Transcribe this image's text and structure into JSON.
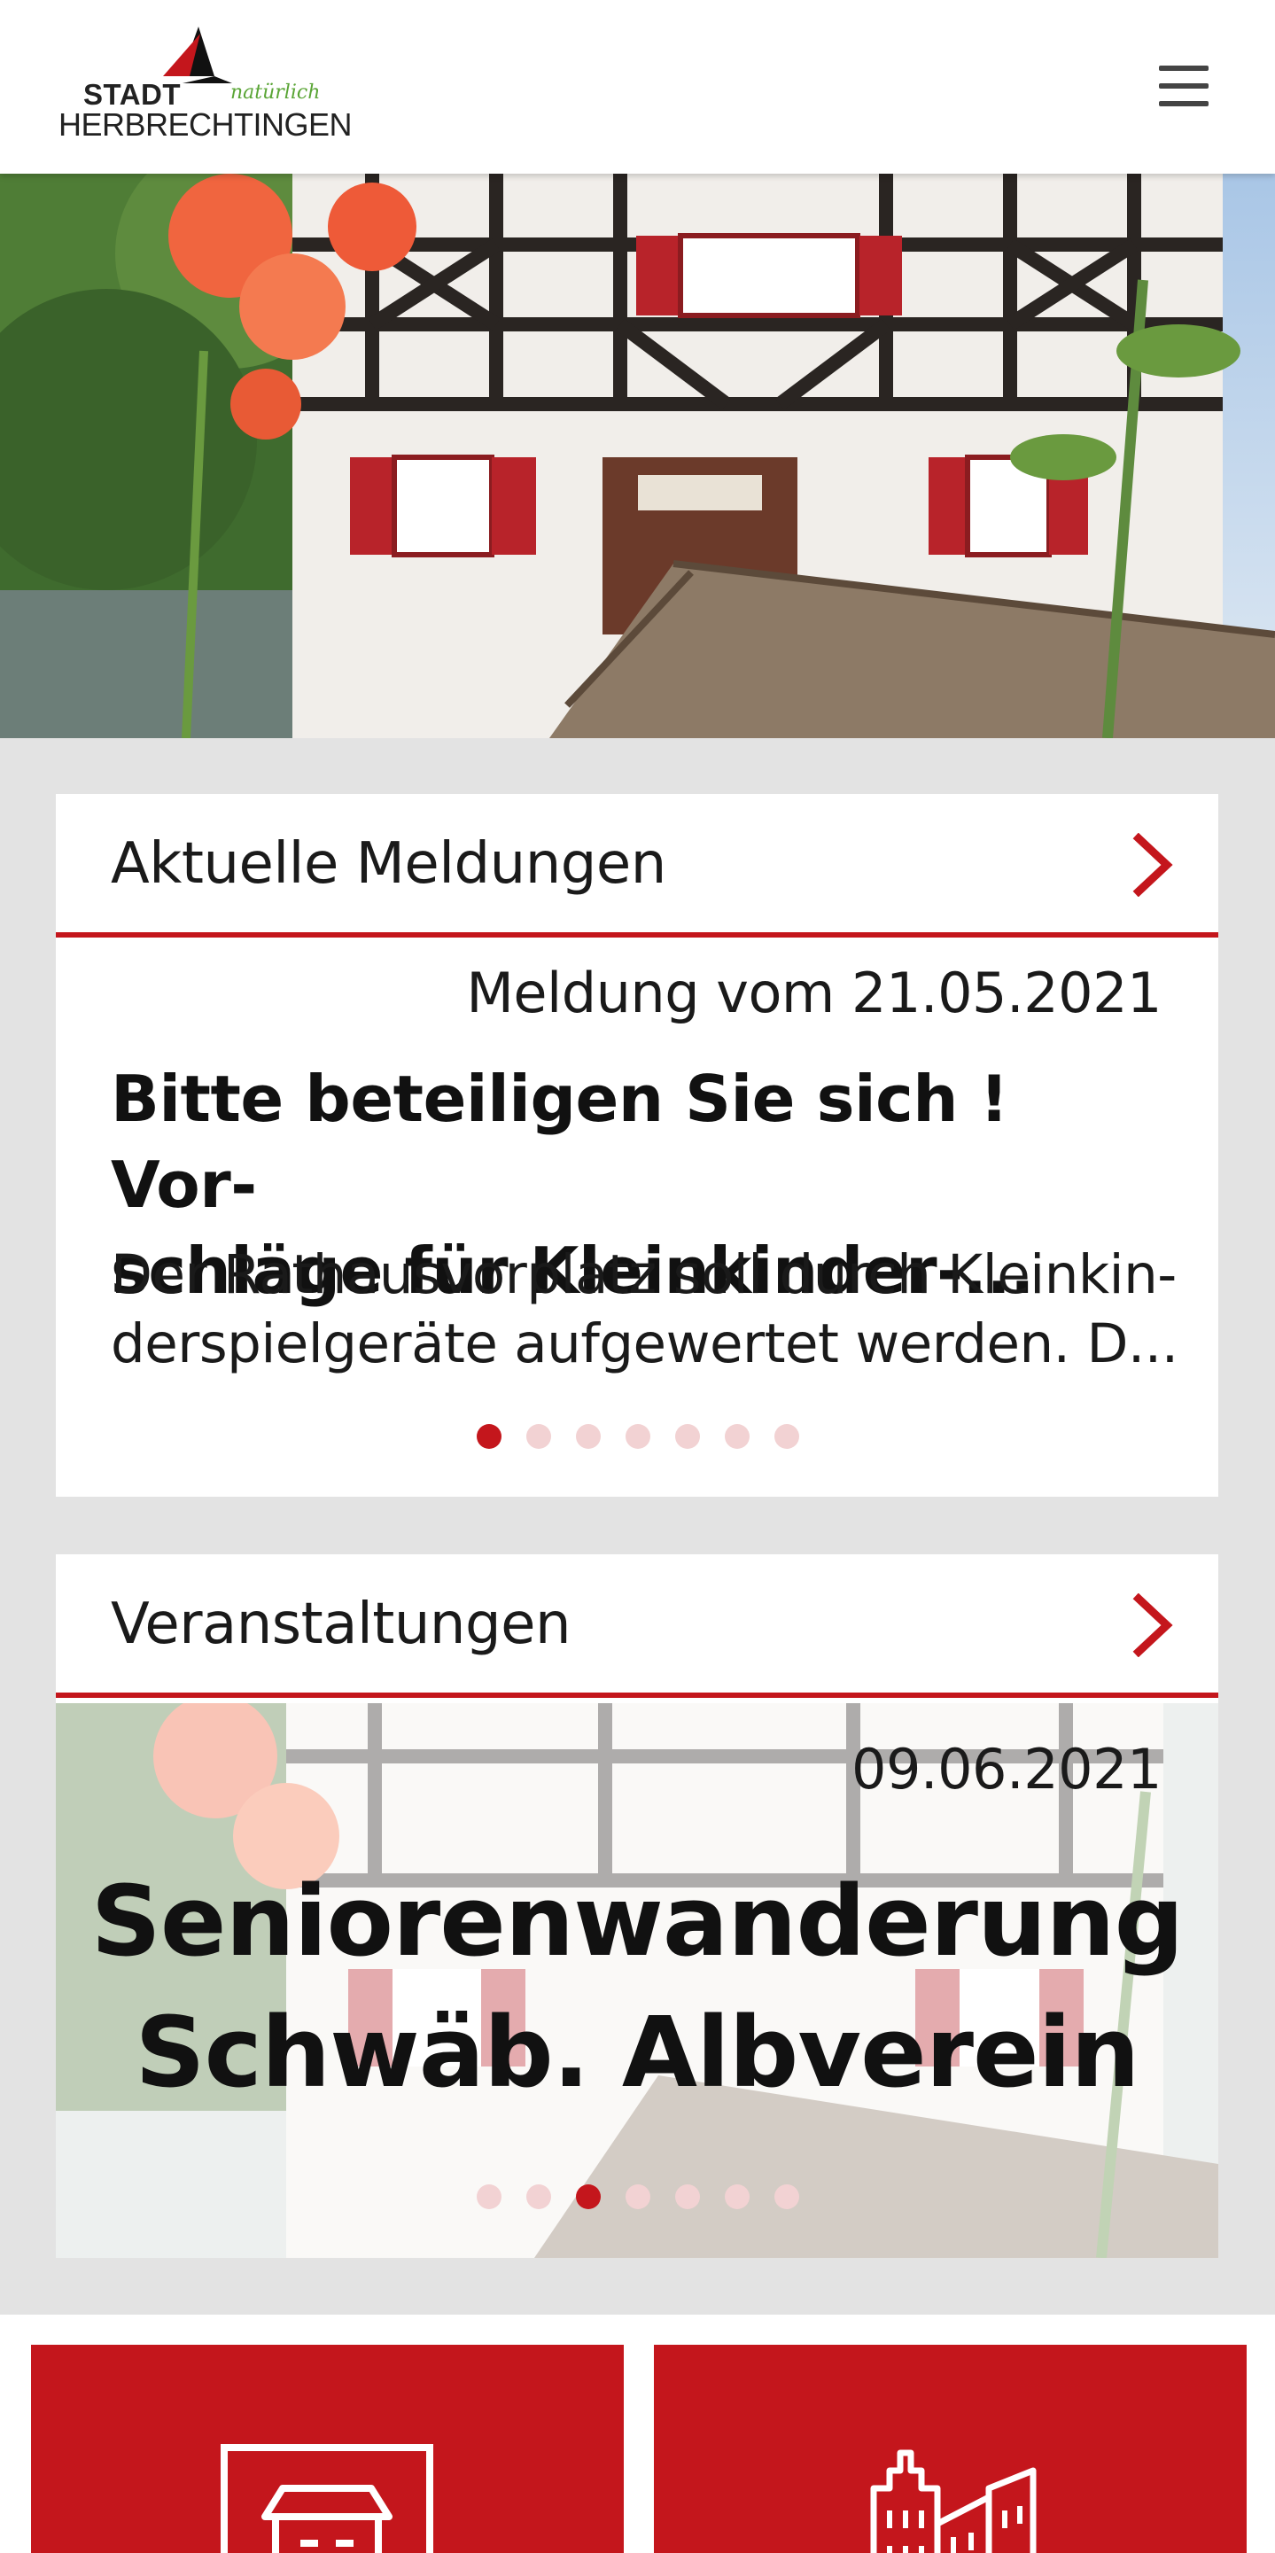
{
  "header": {
    "logo": {
      "word_top": "STADT",
      "tagline": "natürlich",
      "word_bottom": "HERBRECHTINGEN"
    },
    "menu_icon": "hamburger-menu-icon"
  },
  "news": {
    "title": "Aktuelle Meldungen",
    "date": "Meldung vom 21.05.2021",
    "headline_line1": "Bitte beteiligen Sie sich ! Vor-",
    "headline_line2": "schläge für Kleinkinder-...",
    "teaser_line1": "Der Rathausvorplatz soll durch Kleinkin-",
    "teaser_line2": "derspielgeräte aufgewertet werden. D...",
    "slide_count": 7,
    "active_slide": 1
  },
  "events": {
    "title": "Veranstaltungen",
    "date": "09.06.2021",
    "title_line1": "Seniorenwanderung",
    "title_line2": "Schwäb. Albverein",
    "slide_count": 7,
    "active_slide": 3
  },
  "tiles": [
    {
      "icon": "market-stall-icon"
    },
    {
      "icon": "city-buildings-icon"
    }
  ],
  "colors": {
    "accent": "#c4161c",
    "dot_inactive": "#f2d2d3",
    "page_bg": "#e3e3e3"
  }
}
